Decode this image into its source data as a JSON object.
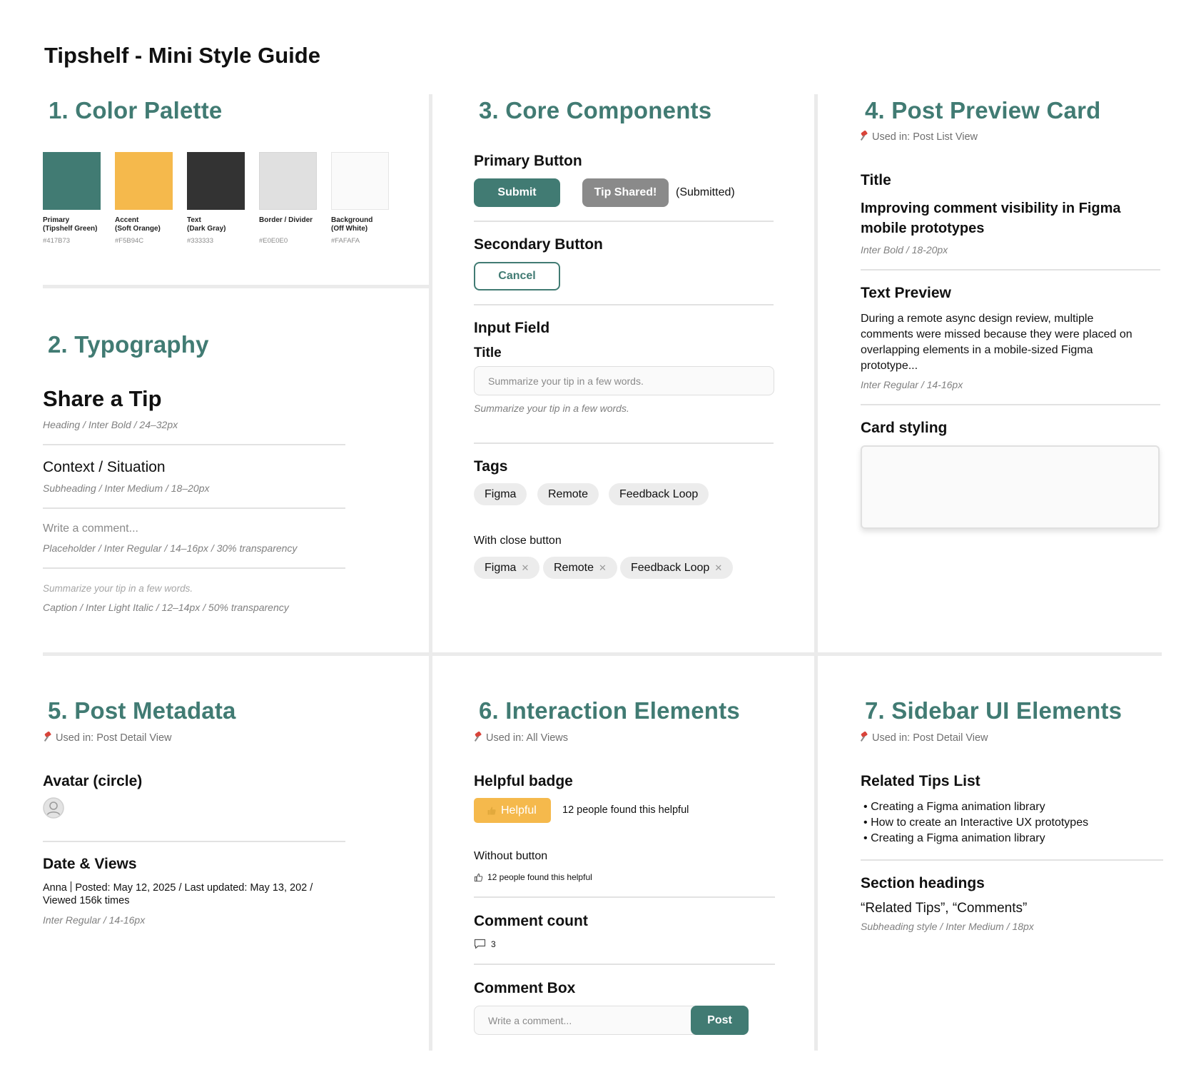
{
  "page_title": "Tipshelf - Mini Style Guide",
  "palette": {
    "title": "1. Color Palette",
    "colors": [
      {
        "label_line1": "Primary",
        "label_line2": "(Tipshelf Green)",
        "hex": "#417B73"
      },
      {
        "label_line1": "Accent",
        "label_line2": "(Soft Orange)",
        "hex": "#F5B94C"
      },
      {
        "label_line1": "Text",
        "label_line2": "(Dark Gray)",
        "hex": "#333333"
      },
      {
        "label_line1": "Border / Divider",
        "label_line2": "",
        "hex": "#E0E0E0"
      },
      {
        "label_line1": "Background",
        "label_line2": "(Off White)",
        "hex": "#FAFAFA"
      }
    ]
  },
  "typography": {
    "title": "2. Typography",
    "heading_sample": "Share a Tip",
    "heading_note": "Heading / Inter Bold / 24–32px",
    "subheading_sample": "Context / Situation",
    "subheading_note": "Subheading / Inter Medium / 18–20px",
    "placeholder_sample": "Write a comment...",
    "placeholder_note": "Placeholder / Inter Regular / 14–16px / 30% transparency",
    "caption_sample": "Summarize your tip in a few words.",
    "caption_note": "Caption / Inter Light Italic / 12–14px / 50% transparency"
  },
  "core": {
    "title": "3. Core Components",
    "primary_heading": "Primary Button",
    "submit_label": "Submit",
    "tip_shared_label": "Tip Shared!",
    "submitted_note": "(Submitted)",
    "secondary_heading": "Secondary Button",
    "cancel_label": "Cancel",
    "input_heading": "Input Field",
    "input_label": "Title",
    "input_placeholder": "Summarize your tip in a few words.",
    "input_caption": "Summarize your tip in a few words.",
    "tags_heading": "Tags",
    "tags": [
      "Figma",
      "Remote",
      "Feedback Loop"
    ],
    "close_heading": "With close button",
    "close_tags": [
      "Figma",
      "Remote",
      "Feedback Loop"
    ],
    "close_glyph": "✕"
  },
  "preview": {
    "title": "4. Post Preview Card",
    "used_in": "Used in: Post List View",
    "title_heading": "Title",
    "sample_title_line1": "Improving comment visibility in Figma",
    "sample_title_line2": "mobile prototypes",
    "title_note": "Inter Bold / 18-20px",
    "text_heading": "Text Preview",
    "text_lines": [
      "During a remote async design review, multiple",
      "comments were missed because they were placed on",
      "overlapping elements in a mobile-sized Figma",
      "prototype..."
    ],
    "text_note": "Inter Regular / 14-16px",
    "card_heading": "Card styling"
  },
  "metadata": {
    "title": "5. Post Metadata",
    "used_in": "Used in: Post Detail View",
    "avatar_heading": "Avatar (circle)",
    "date_heading": "Date & Views",
    "author": "Anna",
    "meta_line1": "Posted: May 12, 2025 / Last updated: May 13, 202 /",
    "meta_line2": "Viewed 156k times",
    "note": "Inter Regular / 14-16px"
  },
  "interaction": {
    "title": "6. Interaction Elements",
    "used_in": "Used in: All Views",
    "badge_heading": "Helpful badge",
    "badge_label": "Helpful",
    "badge_count_text": "12 people found this helpful",
    "without_heading": "Without button",
    "without_text": "12 people found this helpful",
    "comment_count_heading": "Comment count",
    "comment_count": "3",
    "comment_box_heading": "Comment Box",
    "comment_placeholder": "Write a comment...",
    "post_label": "Post"
  },
  "sidebar": {
    "title": "7. Sidebar UI Elements",
    "used_in": "Used in: Post Detail View",
    "related_heading": "Related Tips List",
    "related_items": [
      "Creating a Figma animation library",
      "How to create an Interactive UX prototypes",
      "Creating a Figma animation library"
    ],
    "bullet": "•",
    "section_heading": "Section headings",
    "section_sample": "“Related Tips”, “Comments”",
    "section_note": "Subheading style / Inter Medium / 18px"
  },
  "colors": {
    "primary": "#417B73",
    "accent": "#F5B94C",
    "text": "#333333",
    "divider": "#E0E0E0",
    "background": "#FAFAFA",
    "disabled": "#8A8A8A"
  },
  "icons": [
    "pin-icon",
    "avatar-icon",
    "thumbs-up-icon",
    "comment-icon",
    "close-icon"
  ]
}
